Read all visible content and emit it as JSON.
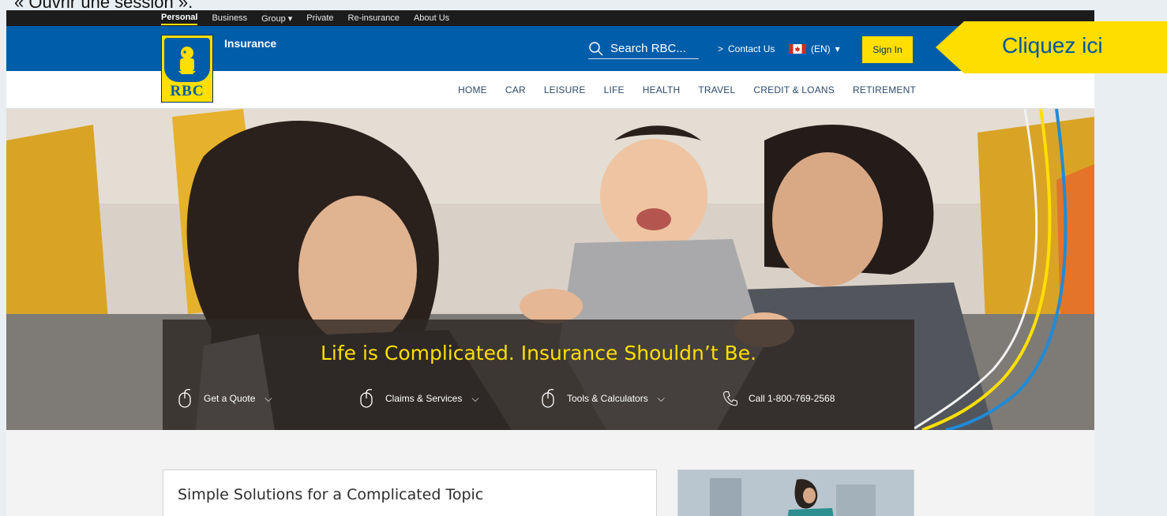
{
  "caption": "« Ouvrir une session ».",
  "utility_nav": {
    "items": [
      {
        "label": "Personal",
        "active": true
      },
      {
        "label": "Business",
        "active": false
      },
      {
        "label": "Group ▾",
        "active": false
      },
      {
        "label": "Private",
        "active": false
      },
      {
        "label": "Re-insurance",
        "active": false
      },
      {
        "label": "About Us",
        "active": false
      }
    ]
  },
  "header": {
    "logo_text": "RBC",
    "section_title": "Insurance",
    "search_placeholder": "Search RBC...",
    "contact_label": "Contact Us",
    "contact_arrow": ">",
    "language_label": "(EN)",
    "language_caret": "▾",
    "signin_label": "Sign In"
  },
  "main_nav": {
    "items": [
      "HOME",
      "CAR",
      "LEISURE",
      "LIFE",
      "HEALTH",
      "TRAVEL",
      "CREDIT & LOANS",
      "RETIREMENT"
    ]
  },
  "hero": {
    "headline": "Life is Complicated. Insurance Shouldn’t Be.",
    "quick_links": [
      {
        "label": "Get a Quote",
        "caret": "⌵",
        "icon": "mouse-icon"
      },
      {
        "label": "Claims & Services",
        "caret": "⌵",
        "icon": "mouse-icon"
      },
      {
        "label": "Tools & Calculators",
        "caret": "⌵",
        "icon": "mouse-icon"
      },
      {
        "label": "Call 1-800-769-2568",
        "caret": "",
        "icon": "phone-icon"
      }
    ]
  },
  "content": {
    "card_title": "Simple Solutions for a Complicated Topic"
  },
  "callout": {
    "label": "Cliquez ici"
  },
  "colors": {
    "rbc_blue": "#005daa",
    "rbc_yellow": "#fedf01",
    "callout_yellow": "#fedd00",
    "callout_text": "#0055a5"
  }
}
